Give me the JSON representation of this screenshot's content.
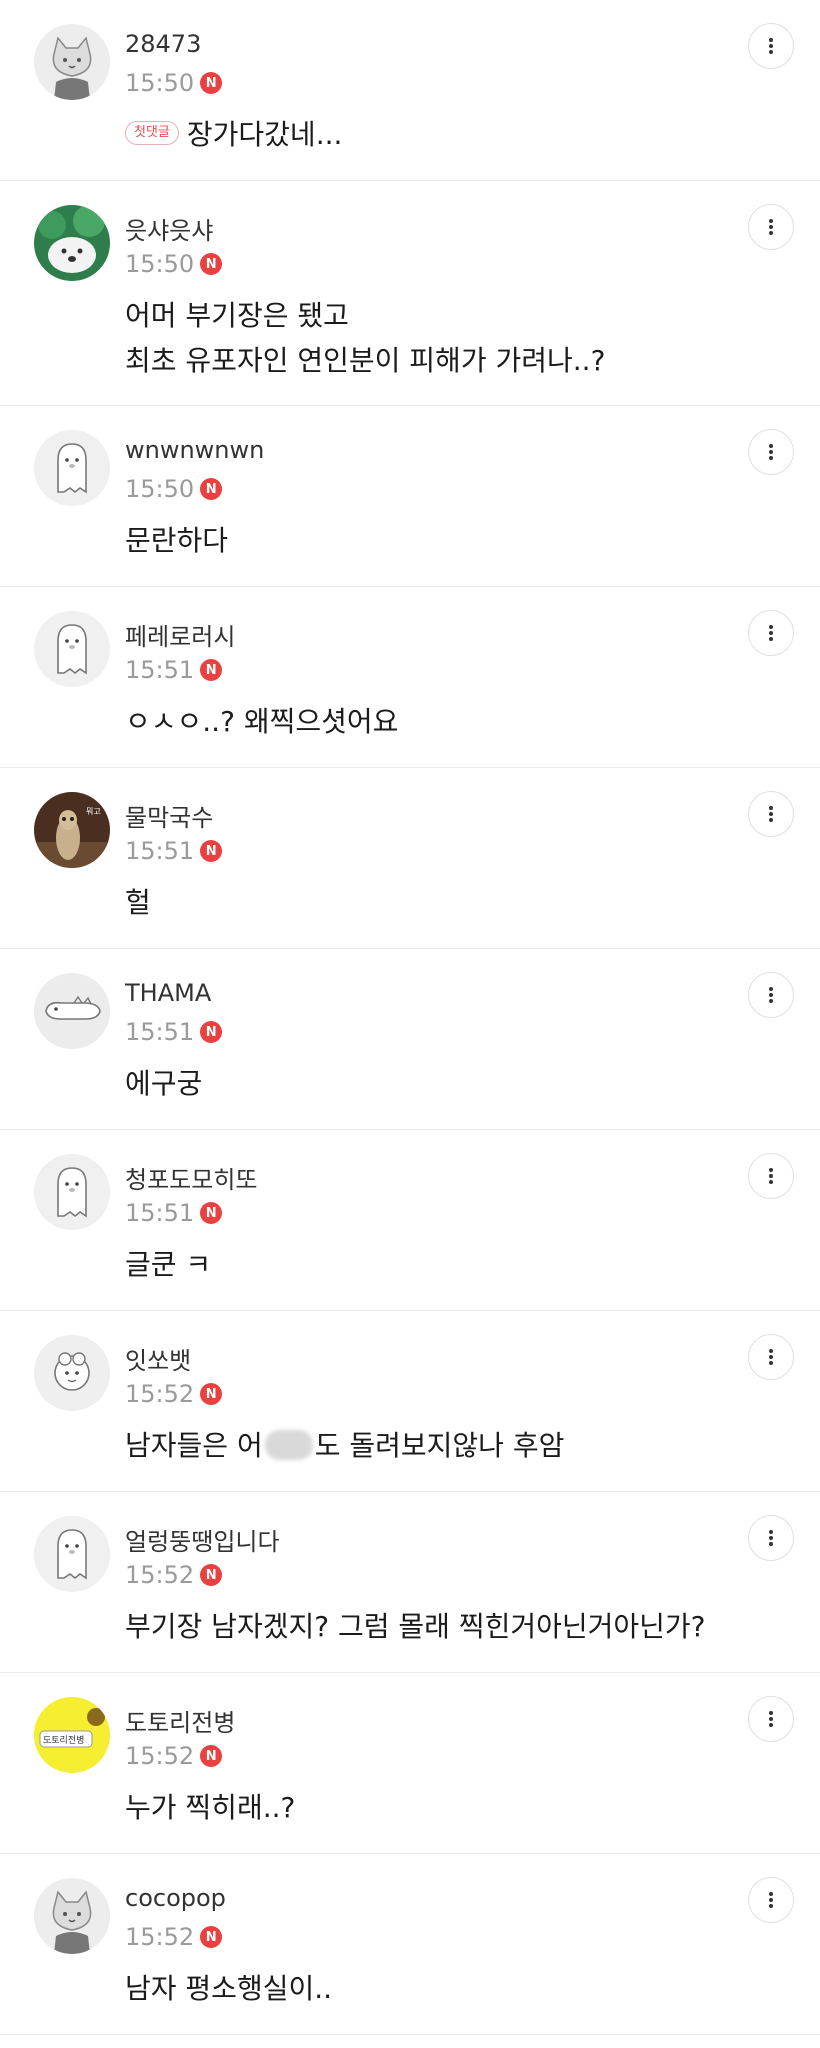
{
  "comments": [
    {
      "author": "28473",
      "time": "15:50",
      "new": "N",
      "badge": "첫댓글",
      "lines": [
        "장가다갔네..."
      ],
      "avatar": "gray-cat-avatar"
    },
    {
      "author": "읏샤읏샤",
      "time": "15:50",
      "new": "N",
      "lines": [
        "어머 부기장은 됐고",
        "최초 유포자인 연인분이 피해가 가려나..?"
      ],
      "avatar": "green-puppy-avatar"
    },
    {
      "author": "wnwnwnwn",
      "time": "15:50",
      "new": "N",
      "lines": [
        "문란하다"
      ],
      "avatar": "ghost-doodle-avatar"
    },
    {
      "author": "페레로러시",
      "time": "15:51",
      "new": "N",
      "lines": [
        "ㅇㅅㅇ..? 왜찍으셧어요"
      ],
      "avatar": "ghost-doodle-avatar"
    },
    {
      "author": "물막국수",
      "time": "15:51",
      "new": "N",
      "lines": [
        "헐"
      ],
      "avatar": "meerkat-photo-avatar"
    },
    {
      "author": "THAMA",
      "time": "15:51",
      "new": "N",
      "lines": [
        "에구궁"
      ],
      "avatar": "lizard-doodle-avatar"
    },
    {
      "author": "청포도모히또",
      "time": "15:51",
      "new": "N",
      "lines": [
        "글쿤 ㅋ"
      ],
      "avatar": "ghost-doodle-avatar"
    },
    {
      "author": "잇쏘뱃",
      "time": "15:52",
      "new": "N",
      "lines_parts": {
        "before": "남자들은 ",
        "partial": "어",
        "after": "도 돌려보지않나 후암"
      },
      "avatar": "sheep-doodle-avatar"
    },
    {
      "author": "얼렁뚱땡입니다",
      "time": "15:52",
      "new": "N",
      "lines": [
        "부기장 남자겠지? 그럼 몰래 찍힌거아닌거아닌가?"
      ],
      "avatar": "ghost-doodle-avatar"
    },
    {
      "author": "도토리전병",
      "time": "15:52",
      "new": "N",
      "lines": [
        "누가 찍히래..?"
      ],
      "avatar": "yellow-sticker-avatar",
      "avatar_text": "도토리전병"
    },
    {
      "author": "cocopop",
      "time": "15:52",
      "new": "N",
      "lines": [
        "남자 평소행실이.."
      ],
      "avatar": "gray-cat-avatar"
    }
  ],
  "colors": {
    "new_badge": "#e9413f",
    "time": "#9a9a9a",
    "divider": "#ebebeb"
  }
}
